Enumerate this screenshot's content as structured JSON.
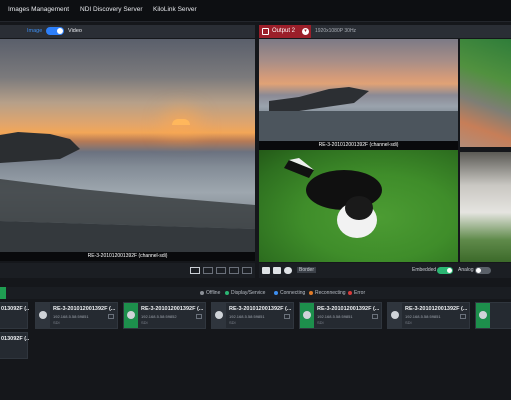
{
  "nav": {
    "items": [
      "Images Management",
      "NDI Discovery Server",
      "KiloLink Server"
    ]
  },
  "left_panel": {
    "toggle_on_label": "Image",
    "toggle_off_label": "Video",
    "caption": "RE-3-201012001392F (channel-sdi)"
  },
  "right_panel": {
    "output_label": "Output 2",
    "resolution": "1920x1080P 30Hz",
    "caption": "RE-3-201012001392F (channel-sdi)",
    "embedded_label": "Embedded",
    "analog_label": "Analog",
    "border_label": "Border",
    "colors": {
      "output_tab": "#9b1f2a",
      "toggle_on": "#2bb673",
      "switch_blue": "#2d7ff9"
    }
  },
  "legend": [
    {
      "label": "Offline",
      "color": "#8a8f96"
    },
    {
      "label": "Display/Service",
      "color": "#2bb673"
    },
    {
      "label": "Connecting",
      "color": "#3d8ef0"
    },
    {
      "label": "Reconnecting",
      "color": "#e07b28"
    },
    {
      "label": "Error",
      "color": "#d93a3a"
    }
  ],
  "devices": {
    "row1": [
      {
        "title": "013092F (..",
        "ip": "",
        "sub": ""
      },
      {
        "title": "RE-3-201012001392F (...",
        "ip": "192.168.5.58:59851",
        "sub": "SDI"
      },
      {
        "title": "RE-3-201012001392F (...",
        "ip": "192.168.5.58:59852",
        "sub": "SDI"
      },
      {
        "title": "RE-3-201012001392F (...",
        "ip": "192.168.5.58:59851",
        "sub": "SDI"
      },
      {
        "title": "RE-3-201012001392F (...",
        "ip": "192.168.5.58:59851",
        "sub": "SDI"
      },
      {
        "title": "RE-3-201012001392F (...",
        "ip": "192.168.5.58:59851",
        "sub": "SDI"
      }
    ],
    "row2": [
      {
        "title": "013092F (..",
        "ip": "",
        "sub": ""
      }
    ]
  }
}
